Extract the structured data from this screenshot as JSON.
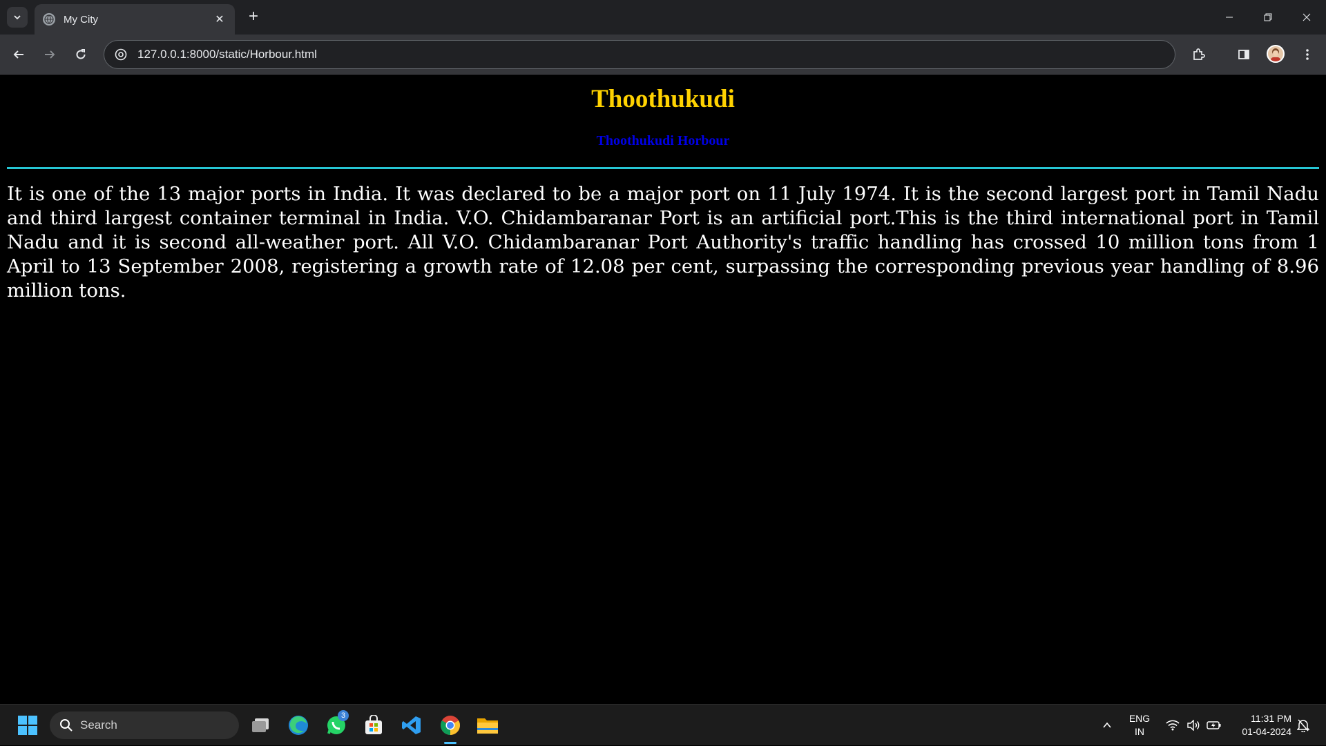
{
  "browser": {
    "tab_title": "My City",
    "url": "127.0.0.1:8000/static/Horbour.html"
  },
  "page": {
    "title": "Thoothukudi",
    "subtitle": "Thoothukudi Horbour",
    "paragraph": "It is one of the 13 major ports in India. It was declared to be a major port on 11 July 1974. It is the second largest port in Tamil Nadu and third largest container terminal in India. V.O. Chidambaranar Port is an artificial port.This is the third international port in Tamil Nadu and it is second all-weather port. All V.O. Chidambaranar Port Authority's traffic handling has crossed 10 million tons from 1 April to 13 September 2008, registering a growth rate of 12.08 per cent, surpassing the corresponding previous year handling of 8.96 million tons.",
    "colors": {
      "title": "#ffd200",
      "subtitle": "#0000e6",
      "divider": "#26c6d4",
      "text": "#ffffff",
      "background": "#000000"
    }
  },
  "taskbar": {
    "search_label": "Search",
    "whatsapp_badge": "3",
    "lang_line1": "ENG",
    "lang_line2": "IN",
    "time": "11:31 PM",
    "date": "01-04-2024",
    "icons": [
      "windows-start-icon",
      "search-icon",
      "task-view-icon",
      "edge-icon",
      "whatsapp-icon",
      "store-icon",
      "vscode-icon",
      "chrome-icon",
      "file-explorer-icon"
    ]
  }
}
